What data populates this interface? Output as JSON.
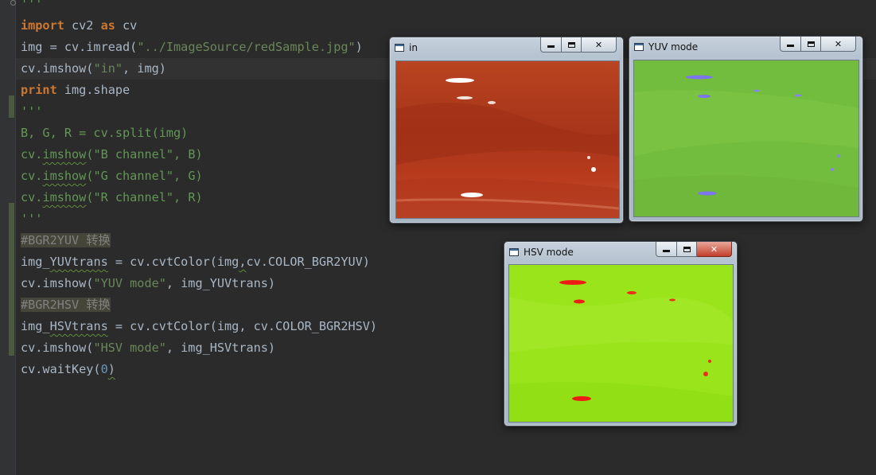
{
  "editor": {
    "lines": [
      {
        "id": "l0",
        "segments": [
          {
            "t": "'''",
            "c": "doc"
          }
        ]
      },
      {
        "id": "l1",
        "segments": [
          {
            "t": "import",
            "c": "kw"
          },
          {
            "t": " cv2 ",
            "c": ""
          },
          {
            "t": "as",
            "c": "kw"
          },
          {
            "t": " cv",
            "c": ""
          }
        ]
      },
      {
        "id": "l2",
        "segments": [
          {
            "t": "img = cv.imread(",
            "c": ""
          },
          {
            "t": "\"../ImageSource/redSample.jpg\"",
            "c": "str"
          },
          {
            "t": ")",
            "c": ""
          }
        ]
      },
      {
        "id": "l3",
        "segments": [
          {
            "t": "cv.imshow(",
            "c": ""
          },
          {
            "t": "\"in\"",
            "c": "str"
          },
          {
            "t": ", img)",
            "c": ""
          }
        ],
        "current": true
      },
      {
        "id": "l4",
        "segments": [
          {
            "t": "print",
            "c": "kw"
          },
          {
            "t": " img.shape",
            "c": ""
          }
        ]
      },
      {
        "id": "l5",
        "segments": [
          {
            "t": "'''",
            "c": "doc"
          }
        ]
      },
      {
        "id": "l6",
        "segments": [
          {
            "t": "B, G, R = cv.split(img)",
            "c": "doc"
          }
        ]
      },
      {
        "id": "l7",
        "segments": [
          {
            "t": "cv.",
            "c": "doc"
          },
          {
            "t": "imshow",
            "c": "doc sq"
          },
          {
            "t": "(\"B channel\", B)",
            "c": "doc"
          }
        ]
      },
      {
        "id": "l8",
        "segments": [
          {
            "t": "cv.",
            "c": "doc"
          },
          {
            "t": "imshow",
            "c": "doc sq"
          },
          {
            "t": "(\"G channel\", G)",
            "c": "doc"
          }
        ]
      },
      {
        "id": "l9",
        "segments": [
          {
            "t": "cv.",
            "c": "doc"
          },
          {
            "t": "imshow",
            "c": "doc sq"
          },
          {
            "t": "(\"R channel\", R)",
            "c": "doc"
          }
        ]
      },
      {
        "id": "l10",
        "segments": [
          {
            "t": "'''",
            "c": "doc"
          }
        ]
      },
      {
        "id": "l11",
        "segments": [
          {
            "t": "#BGR2YUV 转换",
            "c": "cmt"
          }
        ]
      },
      {
        "id": "l12",
        "segments": [
          {
            "t": "img_",
            "c": ""
          },
          {
            "t": "YUVtrans",
            "c": "sq"
          },
          {
            "t": " = cv.cvtColor(img",
            "c": ""
          },
          {
            "t": ",",
            "c": "sq"
          },
          {
            "t": "cv.COLOR_BGR2YUV)",
            "c": ""
          }
        ]
      },
      {
        "id": "l13",
        "segments": [
          {
            "t": "cv.imshow(",
            "c": ""
          },
          {
            "t": "\"YUV mode\"",
            "c": "str"
          },
          {
            "t": ", img_YUVtrans)",
            "c": ""
          }
        ]
      },
      {
        "id": "l14",
        "segments": [
          {
            "t": "#BGR2HSV 转换",
            "c": "cmt"
          }
        ]
      },
      {
        "id": "l15",
        "segments": [
          {
            "t": "img_",
            "c": ""
          },
          {
            "t": "HSVtrans",
            "c": "sq"
          },
          {
            "t": " = cv.cvtColor(img, cv.COLOR_BGR2HSV)",
            "c": ""
          }
        ]
      },
      {
        "id": "l16",
        "segments": [
          {
            "t": "cv.imshow(",
            "c": ""
          },
          {
            "t": "\"HSV mode\"",
            "c": "str"
          },
          {
            "t": ", img_HSVtrans)",
            "c": ""
          }
        ]
      },
      {
        "id": "l17",
        "segments": [
          {
            "t": "cv.waitKey(",
            "c": ""
          },
          {
            "t": "0",
            "c": "num"
          },
          {
            "t": ")",
            "c": "sq"
          }
        ]
      }
    ]
  },
  "windows": {
    "in": {
      "title": "in"
    },
    "yuv": {
      "title": "YUV mode"
    },
    "hsv": {
      "title": "HSV mode"
    }
  },
  "colors": {
    "in_base": "#b63a1e",
    "yuv_base": "#73bd3e",
    "hsv_base": "#9ae41c",
    "yuv_spot": "#7d74f0",
    "hsv_spot": "#ee1c14"
  },
  "icons": {
    "app": "window-app-icon",
    "min": "minimize-icon",
    "max": "maximize-icon",
    "close": "close-icon"
  }
}
